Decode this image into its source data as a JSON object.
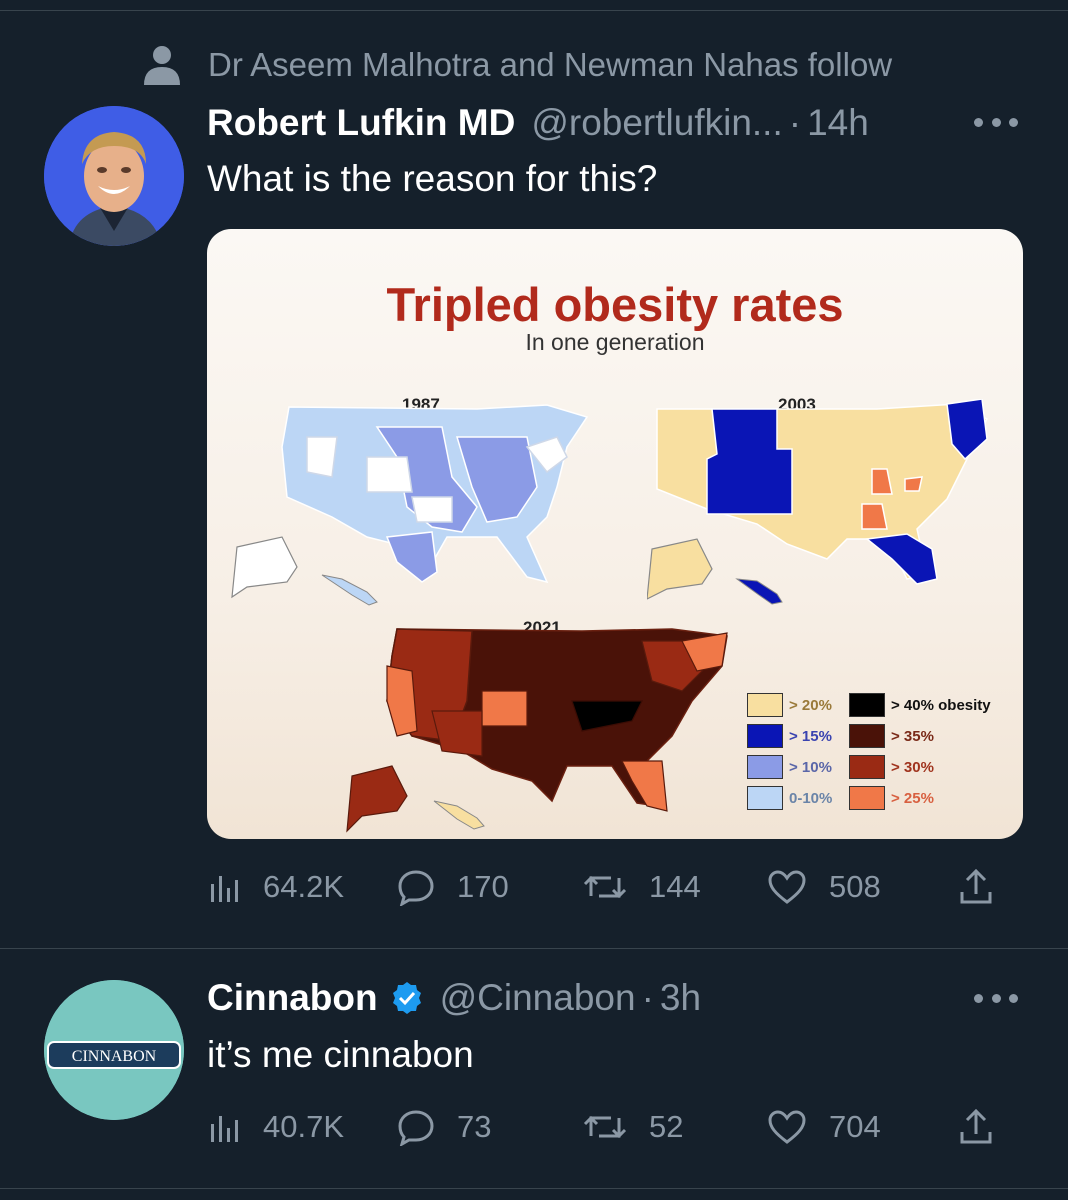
{
  "social_context": "Dr Aseem Malhotra and Newman Nahas follow",
  "tweets": [
    {
      "name": "Robert Lufkin MD",
      "handle": "@robertlufkin...",
      "separator": "·",
      "time": "14h",
      "text": "What is the reason for this?",
      "stats": {
        "views": "64.2K",
        "replies": "170",
        "retweets": "144",
        "likes": "508"
      }
    },
    {
      "name": "Cinnabon",
      "handle": "@Cinnabon",
      "separator": "·",
      "time": "3h",
      "text": "it’s me cinnabon",
      "avatar_text": "CINNABON",
      "verified": true,
      "stats": {
        "views": "40.7K",
        "replies": "73",
        "retweets": "52",
        "likes": "704"
      }
    }
  ],
  "media": {
    "title": "Tripled obesity rates",
    "subtitle": "In one generation",
    "years": [
      "1987",
      "2003",
      "2021"
    ],
    "legend": [
      {
        "label": "> 20%",
        "color": "#f8dfa0",
        "text_color": "#9a7a3a"
      },
      {
        "label": "> 15%",
        "color": "#0a15b5",
        "text_color": "#3a43b0"
      },
      {
        "label": "> 10%",
        "color": "#8b9be6",
        "text_color": "#5a66a8"
      },
      {
        "label": "0-10%",
        "color": "#bcd6f5",
        "text_color": "#6a84a8"
      },
      {
        "label": "> 40% obesity",
        "color": "#000000",
        "text_color": "#111111"
      },
      {
        "label": "> 35%",
        "color": "#4a1208",
        "text_color": "#7a2a18"
      },
      {
        "label": "> 30%",
        "color": "#9a2a14",
        "text_color": "#a0341e"
      },
      {
        "label": "> 25%",
        "color": "#f07848",
        "text_color": "#d86040"
      }
    ]
  },
  "colors": {
    "background": "#15202b",
    "secondary_text": "#8b98a5",
    "divider": "#38444d",
    "verified": "#1d9bf0",
    "title_red": "#b12a1c"
  },
  "icons": [
    "person-icon",
    "more-icon",
    "views-icon",
    "reply-icon",
    "retweet-icon",
    "like-icon",
    "share-icon",
    "verified-badge-icon"
  ]
}
